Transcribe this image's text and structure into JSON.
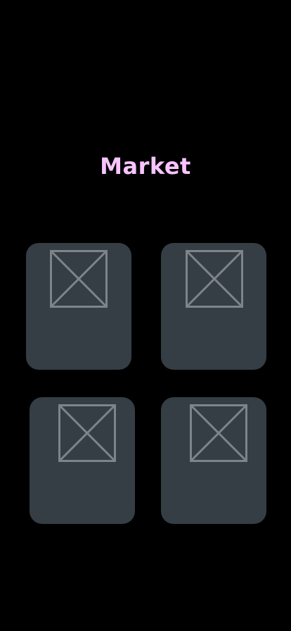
{
  "page": {
    "title": "Market"
  },
  "colors": {
    "background": "#000000",
    "title": "#f7c4ff",
    "card": "#353e45",
    "placeholder_stroke": "#7d848a"
  },
  "market": {
    "items": [
      {
        "icon": "image-placeholder-icon"
      },
      {
        "icon": "image-placeholder-icon"
      },
      {
        "icon": "image-placeholder-icon"
      },
      {
        "icon": "image-placeholder-icon"
      }
    ]
  }
}
